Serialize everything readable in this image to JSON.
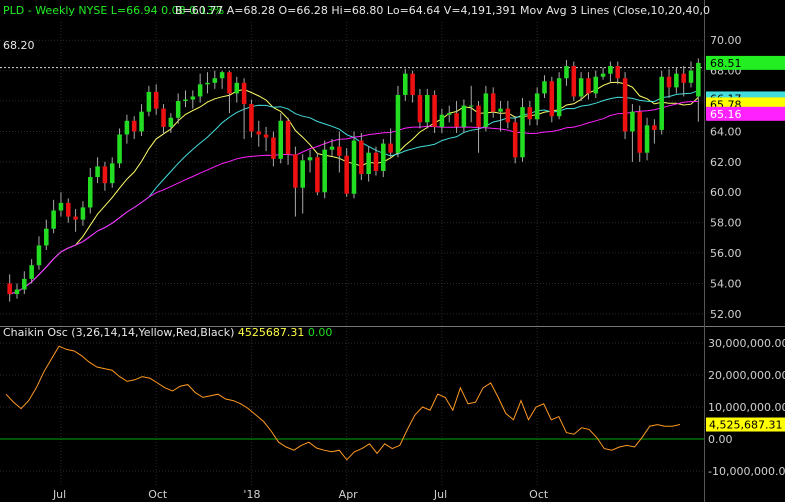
{
  "price_header": {
    "symbol": "PLD",
    "period": "Weekly",
    "exchange": "NYSE",
    "L": "L=66.94",
    "chg": "0.08",
    "chg_pct": "0.13%",
    "B": "B=60.77",
    "A": "A=68.28",
    "O": "O=66.28",
    "Hi": "Hi=68.80",
    "Lo": "Lo=64.64",
    "V": "V=4,191,391",
    "study": "Mov Avg 3 Lines (Close,10,20,40,0"
  },
  "osc_header": {
    "name": "Chaikin Osc (3,26,14,14,Yellow,Red,Black)",
    "value": "4525687.31",
    "delta": "0.00"
  },
  "ref_line_label": "68.20",
  "colors": {
    "up": "#22dd22",
    "down": "#ee1111",
    "ma10": "#ffff66",
    "ma20": "#44dddd",
    "ma40": "#ff22ff",
    "osc_line": "#ff9a22",
    "zero_line": "#00aa00",
    "grid": "#2a2a2a",
    "text": "#cfcfcf"
  },
  "chart_data": [
    {
      "type": "candlestick",
      "ylim": [
        51.2,
        71.2
      ],
      "yticks": [
        "52.00",
        "54.00",
        "56.00",
        "58.00",
        "60.00",
        "62.00",
        "64.00",
        "66.00",
        "68.00",
        "70.00"
      ],
      "xticks": [
        "Jul",
        "Oct",
        "'18",
        "Apr",
        "Jul",
        "Oct"
      ],
      "reference_line": 68.2,
      "last_labels": [
        {
          "value": "68.51",
          "color": "#22ee22",
          "text_color": "#000000",
          "y": 68.51
        },
        {
          "value": "66.17",
          "color": "#44dddd",
          "text_color": "#000000",
          "y": 66.17
        },
        {
          "value": "65.78",
          "color": "#ffff00",
          "text_color": "#000000",
          "y": 65.78
        },
        {
          "value": "65.16",
          "color": "#ff22ff",
          "text_color": "#ffffff",
          "y": 65.16
        }
      ],
      "candles_seed": [
        [
          54.0,
          53.3,
          54.6,
          52.8
        ],
        [
          53.3,
          53.6,
          54.0,
          53.0
        ],
        [
          53.6,
          54.3,
          54.8,
          53.3
        ],
        [
          54.3,
          55.2,
          55.6,
          54.0
        ],
        [
          55.2,
          56.5,
          57.1,
          54.9
        ],
        [
          56.5,
          57.6,
          58.2,
          56.2
        ],
        [
          57.6,
          58.8,
          59.5,
          57.3
        ],
        [
          58.8,
          59.3,
          60.0,
          58.4
        ],
        [
          59.3,
          58.4,
          59.6,
          58.0
        ],
        [
          58.4,
          58.2,
          58.9,
          57.4
        ],
        [
          58.2,
          59.0,
          59.4,
          57.8
        ],
        [
          59.0,
          61.0,
          61.6,
          58.6
        ],
        [
          61.0,
          61.7,
          62.3,
          60.6
        ],
        [
          61.7,
          60.6,
          62.0,
          60.1
        ],
        [
          60.6,
          61.9,
          62.3,
          60.3
        ],
        [
          61.9,
          63.8,
          64.2,
          61.6
        ],
        [
          63.8,
          64.7,
          65.1,
          63.2
        ],
        [
          64.7,
          64.0,
          65.0,
          63.5
        ],
        [
          64.0,
          65.3,
          65.8,
          63.7
        ],
        [
          65.3,
          66.6,
          67.0,
          65.0
        ],
        [
          66.6,
          65.5,
          67.1,
          65.1
        ],
        [
          65.5,
          64.3,
          65.8,
          63.8
        ],
        [
          64.3,
          64.9,
          65.2,
          63.9
        ],
        [
          64.9,
          66.0,
          66.5,
          64.5
        ],
        [
          66.0,
          66.1,
          66.7,
          65.6
        ],
        [
          66.1,
          66.3,
          66.7,
          65.5
        ],
        [
          66.3,
          67.1,
          67.8,
          65.9
        ],
        [
          67.1,
          67.2,
          67.9,
          66.5
        ],
        [
          67.2,
          67.5,
          68.0,
          66.8
        ],
        [
          67.5,
          67.9,
          68.0,
          66.8
        ],
        [
          67.9,
          66.5,
          68.0,
          65.2
        ],
        [
          66.5,
          67.2,
          67.6,
          65.9
        ],
        [
          67.2,
          65.8,
          67.5,
          63.5
        ],
        [
          65.8,
          64.0,
          66.1,
          63.6
        ],
        [
          64.0,
          63.8,
          64.7,
          63.0
        ],
        [
          63.8,
          63.6,
          64.3,
          62.7
        ],
        [
          63.6,
          62.2,
          64.0,
          61.7
        ],
        [
          62.2,
          64.7,
          65.2,
          61.9
        ],
        [
          64.7,
          62.5,
          64.9,
          61.8
        ],
        [
          62.5,
          60.3,
          63.0,
          58.4
        ],
        [
          60.3,
          62.1,
          62.5,
          58.6
        ],
        [
          62.1,
          62.3,
          62.8,
          61.3
        ],
        [
          62.3,
          60.0,
          62.6,
          59.8
        ],
        [
          60.0,
          62.8,
          63.4,
          59.6
        ],
        [
          62.8,
          63.0,
          63.5,
          62.4
        ],
        [
          63.0,
          62.4,
          64.0,
          61.3
        ],
        [
          62.4,
          59.9,
          62.9,
          59.7
        ],
        [
          59.9,
          63.4,
          64.0,
          59.6
        ],
        [
          63.4,
          61.2,
          63.9,
          60.8
        ],
        [
          61.2,
          62.6,
          63.0,
          60.7
        ],
        [
          62.6,
          61.4,
          63.0,
          61.1
        ],
        [
          61.4,
          63.2,
          63.5,
          61.0
        ],
        [
          63.2,
          62.6,
          64.2,
          62.3
        ],
        [
          62.6,
          66.4,
          67.0,
          62.3
        ],
        [
          66.4,
          67.8,
          68.1,
          66.0
        ],
        [
          67.8,
          66.4,
          68.0,
          65.9
        ],
        [
          66.4,
          64.6,
          66.8,
          64.2
        ],
        [
          64.6,
          66.4,
          66.8,
          64.2
        ],
        [
          66.4,
          64.3,
          66.7,
          63.9
        ],
        [
          64.3,
          65.1,
          65.5,
          63.9
        ],
        [
          65.1,
          65.2,
          65.7,
          64.6
        ],
        [
          65.2,
          64.3,
          66.0,
          63.9
        ],
        [
          64.3,
          65.7,
          66.1,
          63.9
        ],
        [
          65.7,
          65.7,
          67.0,
          64.6
        ],
        [
          65.7,
          64.3,
          66.0,
          62.6
        ],
        [
          64.3,
          66.5,
          67.0,
          64.0
        ],
        [
          66.5,
          65.3,
          66.9,
          64.9
        ],
        [
          65.3,
          65.5,
          66.0,
          64.0
        ],
        [
          65.5,
          64.6,
          66.0,
          64.2
        ],
        [
          64.6,
          62.3,
          65.0,
          61.9
        ],
        [
          62.3,
          65.6,
          66.2,
          62.0
        ],
        [
          65.6,
          64.8,
          66.0,
          64.4
        ],
        [
          64.8,
          66.5,
          66.9,
          64.4
        ],
        [
          66.5,
          67.3,
          67.7,
          66.2
        ],
        [
          67.3,
          65.0,
          67.6,
          64.6
        ],
        [
          65.0,
          67.5,
          67.9,
          64.8
        ],
        [
          67.5,
          68.3,
          68.7,
          67.0
        ],
        [
          68.3,
          66.3,
          68.6,
          66.0
        ],
        [
          66.3,
          67.5,
          67.9,
          66.0
        ],
        [
          67.5,
          66.5,
          67.9,
          66.1
        ],
        [
          66.5,
          67.6,
          68.0,
          66.2
        ],
        [
          67.6,
          67.8,
          68.2,
          67.4
        ],
        [
          67.8,
          68.3,
          68.6,
          67.2
        ],
        [
          68.3,
          67.5,
          68.6,
          67.1
        ],
        [
          67.5,
          64.0,
          67.9,
          63.5
        ],
        [
          64.0,
          65.3,
          65.8,
          62.0
        ],
        [
          65.3,
          62.6,
          65.7,
          62.0
        ],
        [
          62.6,
          64.4,
          64.9,
          62.1
        ],
        [
          64.4,
          64.1,
          64.8,
          63.2
        ],
        [
          64.1,
          67.6,
          68.0,
          63.8
        ],
        [
          67.6,
          66.9,
          68.1,
          66.2
        ],
        [
          66.9,
          67.8,
          68.2,
          66.5
        ],
        [
          67.8,
          67.2,
          68.3,
          66.3
        ],
        [
          67.2,
          68.0,
          68.6,
          66.9
        ],
        [
          66.3,
          68.51,
          68.8,
          64.64
        ]
      ],
      "moving_averages": [
        {
          "name": "ma10",
          "period": 10
        },
        {
          "name": "ma20",
          "period": 20
        },
        {
          "name": "ma40",
          "period": 40
        }
      ]
    },
    {
      "type": "line",
      "name": "Chaikin Osc",
      "ylim": [
        -15000000,
        35000000
      ],
      "yticks": [
        "30,000,000.00",
        "20,000,000.00",
        "10,000,000.00",
        "0.00",
        "-10,000,000.00"
      ],
      "ytick_values": [
        30000000,
        20000000,
        10000000,
        0,
        -10000000
      ],
      "last_label": "4,525,687.31",
      "last_value": 4525687.31,
      "values": [
        14000000,
        11500000,
        9500000,
        12000000,
        16000000,
        21000000,
        25000000,
        29000000,
        28000000,
        27500000,
        26000000,
        24000000,
        22500000,
        22000000,
        21500000,
        19500000,
        18000000,
        18500000,
        19500000,
        19000000,
        17500000,
        16000000,
        15000000,
        16500000,
        17000000,
        14500000,
        13000000,
        13500000,
        14000000,
        12500000,
        12000000,
        11000000,
        9500000,
        7500000,
        5500000,
        2500000,
        -1000000,
        -2500000,
        -3500000,
        -2000000,
        -1000000,
        -2800000,
        -3500000,
        -4000000,
        -3500000,
        -6500000,
        -4000000,
        -3000000,
        -1500000,
        -4500000,
        -1500000,
        -3000000,
        -2000000,
        3000000,
        7500000,
        10000000,
        9000000,
        14000000,
        13000000,
        9000000,
        16000000,
        11000000,
        11500000,
        16000000,
        17500000,
        13000000,
        8000000,
        6000000,
        12000000,
        6000000,
        10000000,
        11000000,
        6000000,
        7000000,
        2000000,
        1500000,
        3500000,
        3000000,
        500000,
        -3000000,
        -3500000,
        -2500000,
        -2000000,
        -2500000,
        500000,
        4000000,
        4500000,
        4000000,
        4000000,
        4525687.31
      ]
    }
  ]
}
